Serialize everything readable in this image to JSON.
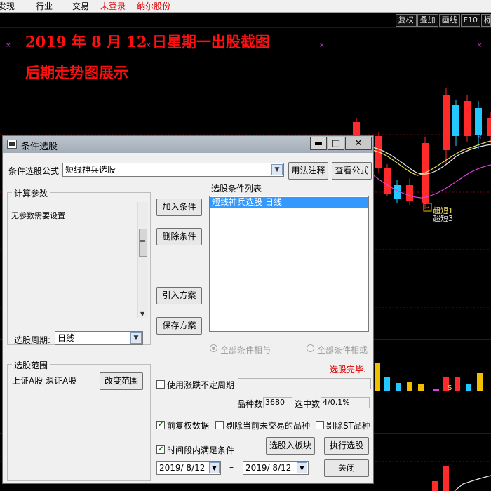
{
  "menu": {
    "items": [
      {
        "label": "发现",
        "color": "#000000"
      },
      {
        "label": "行业",
        "color": "#000000"
      },
      {
        "label": "交易",
        "color": "#000000"
      },
      {
        "label": "未登录",
        "color": "#e00000"
      },
      {
        "label": "纳尔股份",
        "color": "#e00000"
      }
    ]
  },
  "chart": {
    "toolbar": [
      "复权",
      "叠加",
      "画线",
      "F10",
      "标"
    ],
    "headline_1": "2019 年 8 月 12 日星期一出股截图",
    "headline_2": "后期走势图展示",
    "signal_label_1": "超短1",
    "signal_label_2": "超短3",
    "signal_marker": "B",
    "vol_marker": "S",
    "colors": {
      "up": "#ff2a2a",
      "down": "#22c8ff",
      "headline": "#ff1010",
      "grid": "#a01515"
    }
  },
  "dialog": {
    "title": "条件选股",
    "formula_label": "条件选股公式",
    "formula_value": "短线神兵选股  -",
    "usage_button": "用法注释",
    "view_formula_button": "查看公式",
    "params_group": "计算参数",
    "params_text": "无参数需要设置",
    "period_label": "选股周期:",
    "period_value": "日线",
    "range_group": "选股范围",
    "range_text": "上证A股 深证A股",
    "change_range_button": "改变范围",
    "add_condition_button": "加入条件",
    "delete_condition_button": "删除条件",
    "import_plan_button": "引入方案",
    "save_plan_button": "保存方案",
    "condition_list_label": "选股条件列表",
    "condition_list_items": [
      "短线神兵选股  日线"
    ],
    "radio_and": "全部条件相与",
    "radio_or": "全部条件相或",
    "status": "选股完毕.",
    "use_uncertain_period": "使用涨跌不定周期",
    "count_label": "品种数",
    "count_value": "3680",
    "selected_label": "选中数",
    "selected_value": "4/0.1%",
    "pre_adjust": "前复权数据",
    "exclude_untraded": "剔除当前未交易的品种",
    "exclude_st": "剔除ST品种",
    "time_window": "时间段内满足条件",
    "to_block_button": "选股入板块",
    "execute_button": "执行选股",
    "date_from": "2019/ 8/12",
    "date_sep": "–",
    "date_to": "2019/ 8/12",
    "close_button": "关闭"
  }
}
